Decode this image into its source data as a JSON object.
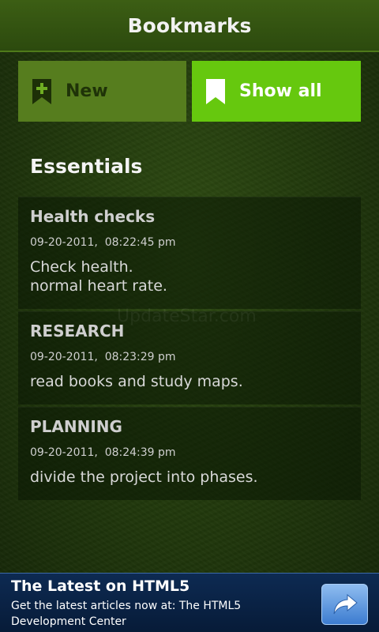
{
  "header": {
    "title": "Bookmarks"
  },
  "actions": {
    "new_label": "New",
    "show_all_label": "Show all"
  },
  "section": {
    "title": "Essentials"
  },
  "bookmarks": [
    {
      "title": "Health checks",
      "date": "09-20-2011,  08:22:45 pm",
      "body": "Check health.\nnormal heart rate."
    },
    {
      "title": "RESEARCH",
      "date": "09-20-2011,  08:23:29 pm",
      "body": "read books and study maps."
    },
    {
      "title": "PLANNING",
      "date": "09-20-2011,  08:24:39 pm",
      "body": "divide the project into phases."
    }
  ],
  "watermark": "UpdateStar.com",
  "ad": {
    "title": "The Latest on HTML5",
    "body": "Get the latest articles now at: The HTML5 Development Center"
  },
  "icons": {
    "new": "bookmark-plus-icon",
    "show_all": "bookmark-icon",
    "ad_action": "share-arrow-icon"
  },
  "colors": {
    "accent": "#66c80e",
    "new_button": "#567d1e",
    "ad_background": "#0d2a52"
  }
}
